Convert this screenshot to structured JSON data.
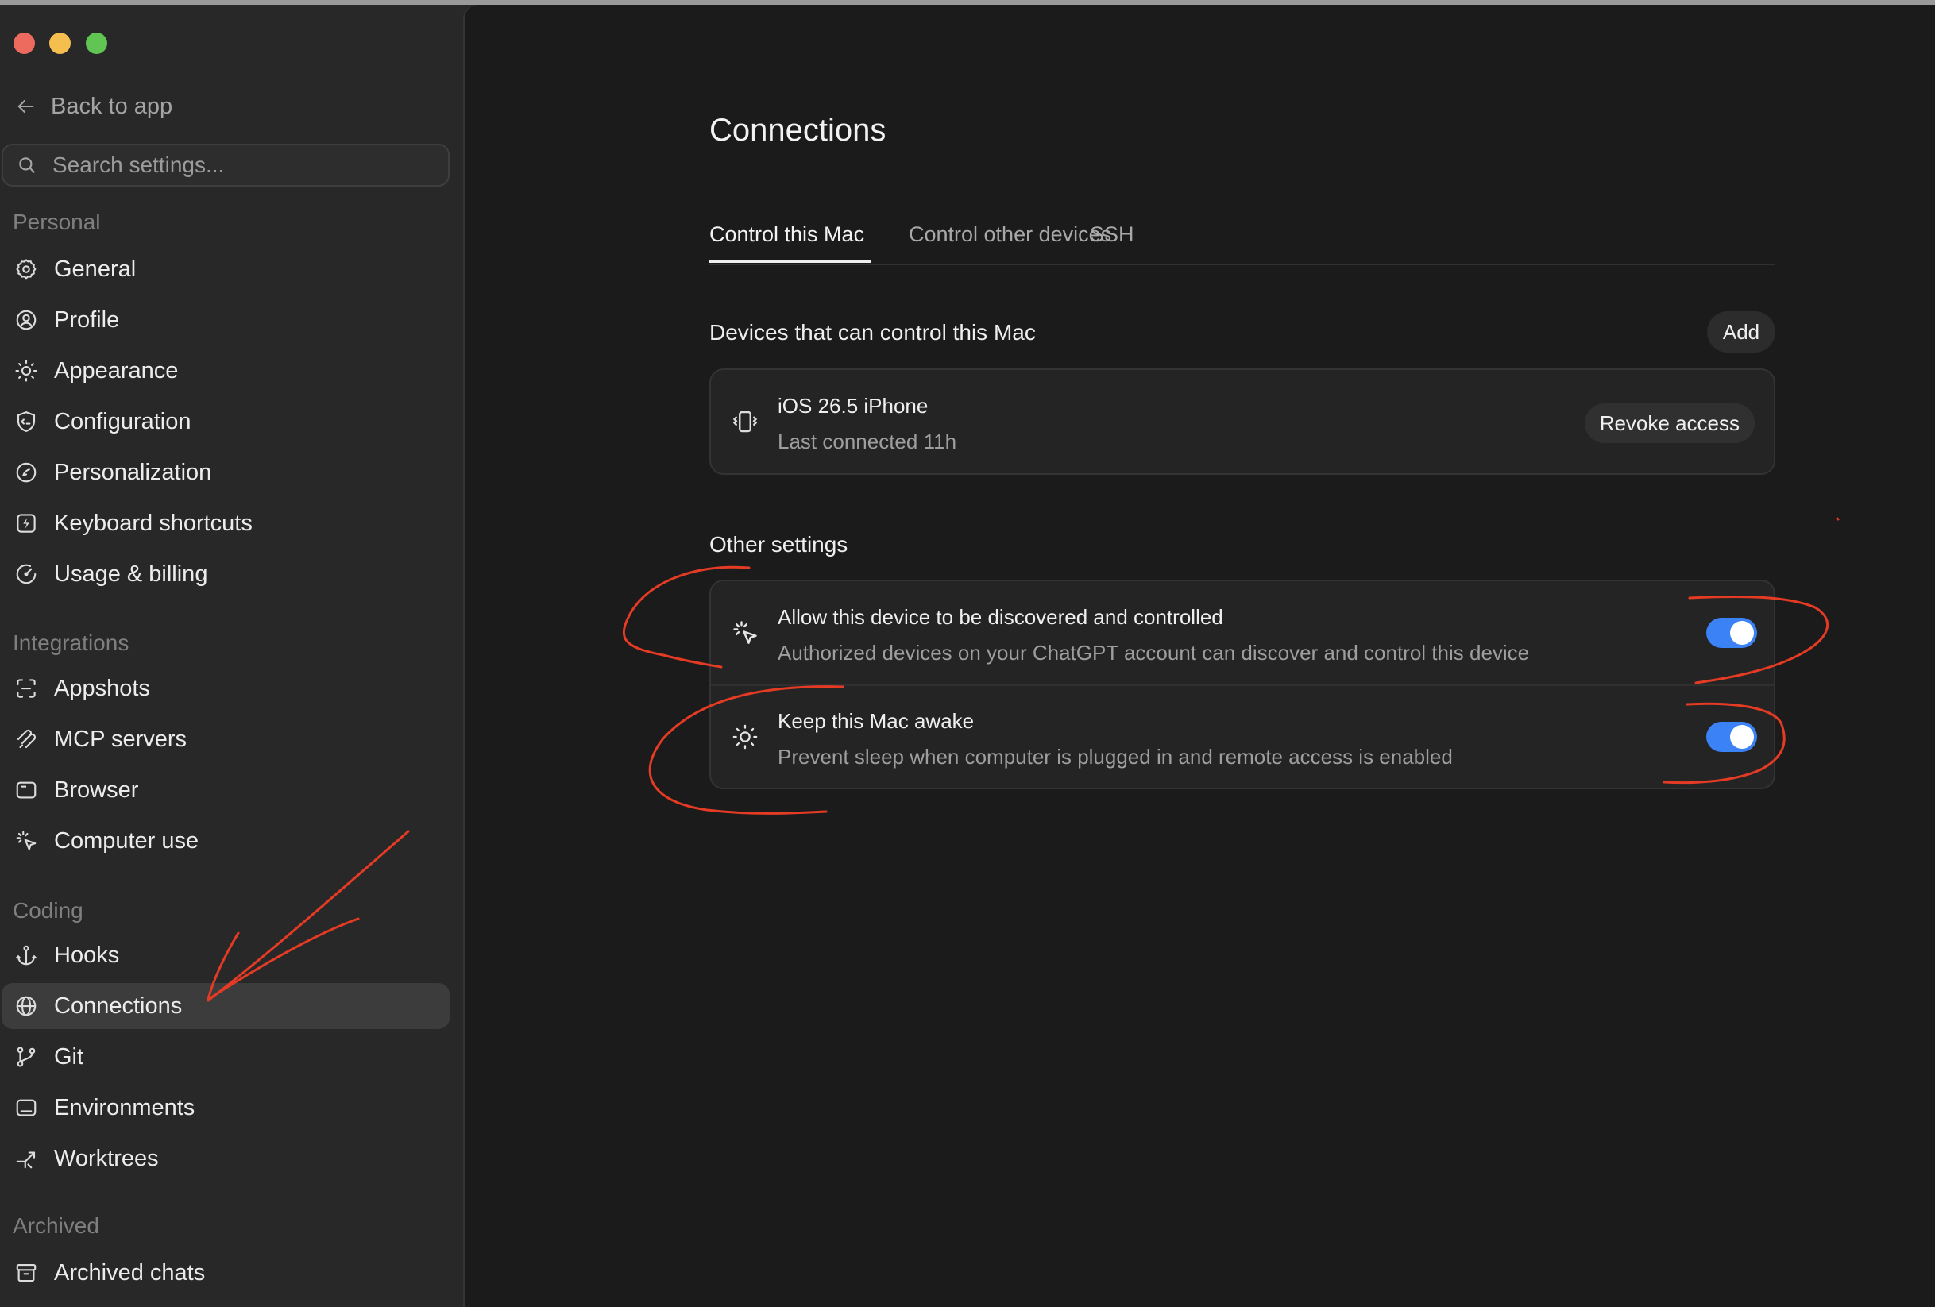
{
  "window": {
    "traffic_lights": [
      {
        "name": "close",
        "color": "#ed6a5e"
      },
      {
        "name": "minimize",
        "color": "#f4bf4f"
      },
      {
        "name": "zoom",
        "color": "#61c554"
      }
    ]
  },
  "sidebar": {
    "back_label": "Back to app",
    "search_placeholder": "Search settings...",
    "sections": [
      {
        "label": "Personal",
        "items": [
          {
            "label": "General",
            "icon": "gear-icon"
          },
          {
            "label": "Profile",
            "icon": "profile-icon"
          },
          {
            "label": "Appearance",
            "icon": "sun-icon"
          },
          {
            "label": "Configuration",
            "icon": "shield-code-icon"
          },
          {
            "label": "Personalization",
            "icon": "personalization-icon"
          },
          {
            "label": "Keyboard shortcuts",
            "icon": "keyboard-bolt-icon"
          },
          {
            "label": "Usage & billing",
            "icon": "gauge-icon"
          }
        ]
      },
      {
        "label": "Integrations",
        "items": [
          {
            "label": "Appshots",
            "icon": "appshots-icon"
          },
          {
            "label": "MCP servers",
            "icon": "mcp-icon"
          },
          {
            "label": "Browser",
            "icon": "browser-icon"
          },
          {
            "label": "Computer use",
            "icon": "cursor-click-icon"
          }
        ]
      },
      {
        "label": "Coding",
        "items": [
          {
            "label": "Hooks",
            "icon": "anchor-icon"
          },
          {
            "label": "Connections",
            "icon": "globe-icon",
            "active": true
          },
          {
            "label": "Git",
            "icon": "git-branch-icon"
          },
          {
            "label": "Environments",
            "icon": "environment-icon"
          },
          {
            "label": "Worktrees",
            "icon": "worktree-icon"
          }
        ]
      },
      {
        "label": "Archived",
        "items": [
          {
            "label": "Archived chats",
            "icon": "archive-icon"
          }
        ]
      }
    ]
  },
  "main": {
    "title": "Connections",
    "tabs": [
      {
        "label": "Control this Mac",
        "active": true
      },
      {
        "label": "Control other devices"
      },
      {
        "label": "SSH"
      }
    ],
    "devices": {
      "title": "Devices that can control this Mac",
      "add_label": "Add",
      "items": [
        {
          "name": "iOS 26.5 iPhone",
          "detail": "Last connected 11h",
          "icon": "phone-vibrate-icon",
          "action_label": "Revoke access"
        }
      ]
    },
    "other_settings": {
      "title": "Other settings",
      "items": [
        {
          "title": "Allow this device to be discovered and controlled",
          "description": "Authorized devices on your ChatGPT account can discover and control this device",
          "icon": "cursor-click-icon",
          "enabled": true
        },
        {
          "title": "Keep this Mac awake",
          "description": "Prevent sleep when computer is plugged in and remote access is enabled",
          "icon": "sun-icon",
          "enabled": true
        }
      ]
    }
  },
  "colors": {
    "sidebar_bg": "#282828",
    "main_bg": "#1b1b1b",
    "toggle_on": "#3b82f6",
    "annotation": "#e53b25"
  }
}
